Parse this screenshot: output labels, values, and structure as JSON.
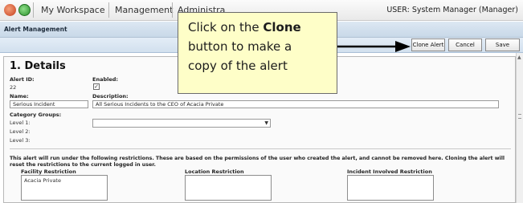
{
  "nav": {
    "items": [
      "My Workspace",
      "Management",
      "Administra"
    ],
    "user": "USER: System Manager (Manager)"
  },
  "page": {
    "title": "Alert Management"
  },
  "toolbar": {
    "clone": "Clone Alert",
    "cancel": "Cancel",
    "save": "Save"
  },
  "details": {
    "title": "1. Details",
    "alert_id_label": "Alert ID:",
    "alert_id": "22",
    "enabled_label": "Enabled:",
    "enabled_mark": "✓",
    "name_label": "Name:",
    "name": "Serious Incident",
    "description_label": "Description:",
    "description": "All Serious Incidents to the CEO of Acacia Private",
    "category_groups_label": "Category Groups:",
    "level1": "Level 1:",
    "level2": "Level 2:",
    "level3": "Level 3:"
  },
  "restrictions": {
    "text": "This alert will run under the following restrictions. These are based on the permissions of the user who created the alert, and cannot be removed here. Cloning the alert will reset the restrictions to the current logged in user.",
    "facility_label": "Facility Restriction",
    "facility_value": "Acacia Private",
    "location_label": "Location Restriction",
    "incident_label": "Incident Involved Restriction"
  },
  "callout": {
    "line1_pre": "Click on the ",
    "line1_bold": "Clone",
    "line2": "button to make a",
    "line3": "copy of the alert"
  },
  "colors": {
    "callout_bg": "#fefec8",
    "header_blue": "#c8d8e8",
    "arrow": "#000000"
  }
}
